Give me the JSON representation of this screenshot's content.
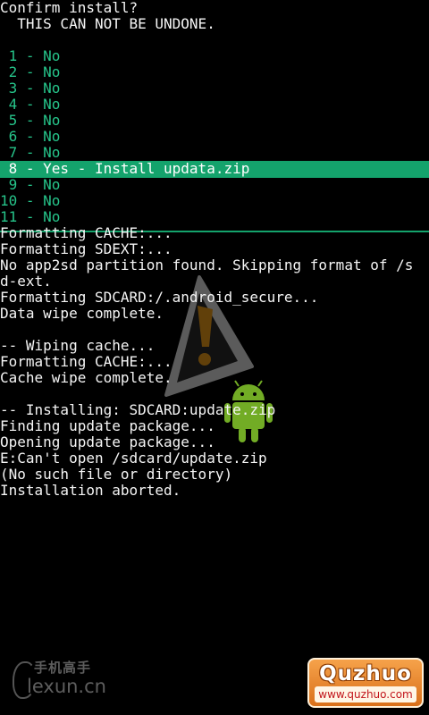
{
  "header": {
    "title": "Confirm install?",
    "warning": "  THIS CAN NOT BE UNDONE."
  },
  "menu": {
    "items": [
      " 1 - No",
      " 2 - No",
      " 3 - No",
      " 4 - No",
      " 5 - No",
      " 6 - No",
      " 7 - No",
      " 8 - Yes - Install updata.zip",
      " 9 - No",
      "10 - No",
      "11 - No"
    ],
    "selected_index": 7
  },
  "log": {
    "lines": [
      "Formatting CACHE:...",
      "Formatting SDEXT:...",
      "No app2sd partition found. Skipping format of /s",
      "d-ext.",
      "Formatting SDCARD:/.android_secure...",
      "Data wipe complete.",
      "",
      "-- Wiping cache...",
      "Formatting CACHE:...",
      "Cache wipe complete.",
      "",
      "-- Installing: SDCARD:update.zip",
      "Finding update package...",
      "Opening update package...",
      "E:Can't open /sdcard/update.zip",
      "(No such file or directory)",
      "Installation aborted."
    ]
  },
  "watermarks": {
    "left_top": "手机高手",
    "left_bottom": "lexun.cn",
    "right_title": "Quzhuo",
    "right_url": "www.quzhuo.com"
  },
  "colors": {
    "background": "#000000",
    "menu_text": "#26c48a",
    "selection_bar": "#14a36c",
    "log_text": "#f5f5f5"
  },
  "icons": {
    "warning": "warning-triangle-icon",
    "mascot": "android-robot-icon"
  }
}
